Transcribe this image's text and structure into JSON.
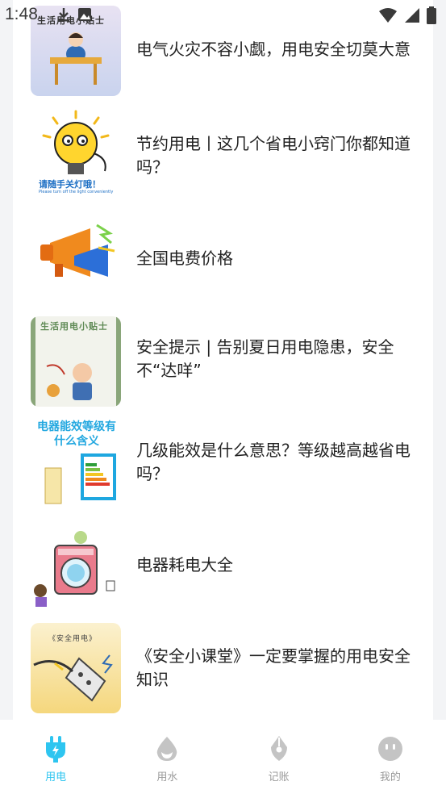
{
  "status_bar": {
    "time": "1:48"
  },
  "articles": [
    {
      "title": "电气火灾不容小觑，用电安全切莫大意",
      "thumb_text": "生活用电小贴士"
    },
    {
      "title": "节约用电丨这几个省电小窍门你都知道吗？",
      "thumb_text": "请随手关灯哦！",
      "thumb_subtext": "Please turn off the light conveniently"
    },
    {
      "title": "全国电费价格"
    },
    {
      "title": "安全提示 | 告别夏日用电隐患，安全不“达咩”",
      "thumb_text": "生活用电小贴士"
    },
    {
      "title": "几级能效是什么意思？等级越高越省电吗？",
      "thumb_text": "电器能效等级有什么含义"
    },
    {
      "title": "电器耗电大全"
    },
    {
      "title": "《安全小课堂》一定要掌握的用电安全知识",
      "thumb_text": "《安全用电》"
    }
  ],
  "tabs": [
    {
      "label": "用电",
      "icon": "plug-icon",
      "active": true
    },
    {
      "label": "用水",
      "icon": "water-drop-icon",
      "active": false
    },
    {
      "label": "记账",
      "icon": "pen-nib-icon",
      "active": false
    },
    {
      "label": "我的",
      "icon": "smiley-icon",
      "active": false
    }
  ],
  "colors": {
    "active_tab": "#2ec5f0",
    "inactive_tab": "#b5b5b5",
    "title_text": "#222222"
  }
}
